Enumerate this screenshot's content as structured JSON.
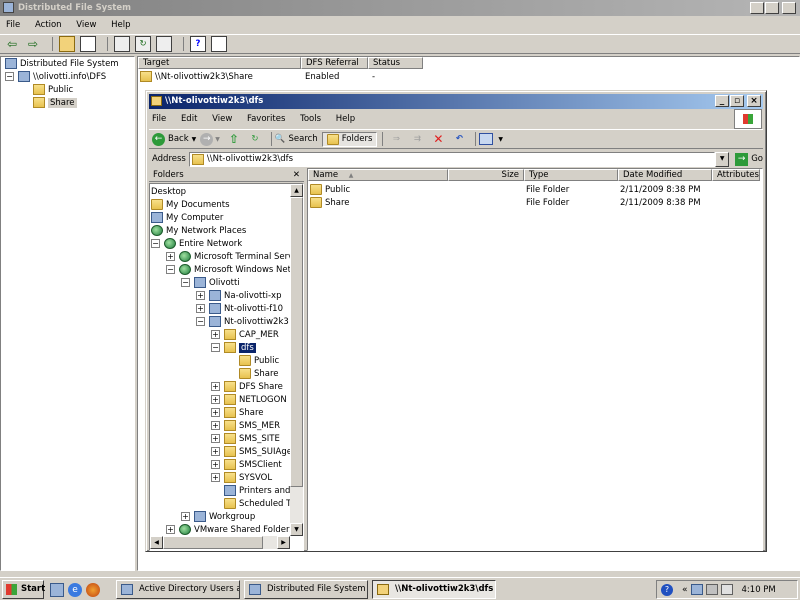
{
  "mmc": {
    "title": "Distributed File System",
    "menu": [
      "File",
      "Action",
      "View",
      "Help"
    ],
    "tree": [
      {
        "label": "Distributed File System"
      },
      {
        "label": "\\\\olivotti.info\\DFS"
      },
      {
        "label": "Public"
      },
      {
        "label": "Share"
      }
    ],
    "columns": [
      "Target",
      "DFS Referral",
      "Status"
    ],
    "rows": [
      {
        "target": "\\\\Nt-olivottiw2k3\\Share",
        "referral": "Enabled",
        "status": "-"
      }
    ]
  },
  "explorer": {
    "title": "\\\\Nt-olivottiw2k3\\dfs",
    "menu": [
      "File",
      "Edit",
      "View",
      "Favorites",
      "Tools",
      "Help"
    ],
    "toolbar": {
      "back": "Back",
      "search": "Search",
      "folders": "Folders"
    },
    "address_label": "Address",
    "address_value": "\\\\Nt-olivottiw2k3\\dfs",
    "go_label": "Go",
    "folders_pane_title": "Folders",
    "folder_tree": [
      {
        "label": "Desktop"
      },
      {
        "label": "My Documents"
      },
      {
        "label": "My Computer"
      },
      {
        "label": "My Network Places"
      },
      {
        "label": "Entire Network"
      },
      {
        "label": "Microsoft Terminal Services"
      },
      {
        "label": "Microsoft Windows Network"
      },
      {
        "label": "Olivotti"
      },
      {
        "label": "Na-olivotti-xp"
      },
      {
        "label": "Nt-olivotti-f10"
      },
      {
        "label": "Nt-olivottiw2k3"
      },
      {
        "label": "CAP_MER"
      },
      {
        "label": "dfs"
      },
      {
        "label": "Public"
      },
      {
        "label": "Share"
      },
      {
        "label": "DFS Share"
      },
      {
        "label": "NETLOGON"
      },
      {
        "label": "Share"
      },
      {
        "label": "SMS_MER"
      },
      {
        "label": "SMS_SITE"
      },
      {
        "label": "SMS_SUIAgent"
      },
      {
        "label": "SMSClient"
      },
      {
        "label": "SYSVOL"
      },
      {
        "label": "Printers and Faxes"
      },
      {
        "label": "Scheduled Tasks"
      },
      {
        "label": "Workgroup"
      },
      {
        "label": "VMware Shared Folders"
      }
    ],
    "columns": [
      "Name",
      "Size",
      "Type",
      "Date Modified",
      "Attributes"
    ],
    "files": [
      {
        "name": "Public",
        "size": "",
        "type": "File Folder",
        "modified": "2/11/2009 8:38 PM",
        "attributes": ""
      },
      {
        "name": "Share",
        "size": "",
        "type": "File Folder",
        "modified": "2/11/2009 8:38 PM",
        "attributes": ""
      }
    ]
  },
  "taskbar": {
    "start": "Start",
    "tasks": [
      "Active Directory Users a...",
      "Distributed File System",
      "\\\\Nt-olivottiw2k3\\dfs"
    ],
    "clock": "4:10 PM"
  }
}
